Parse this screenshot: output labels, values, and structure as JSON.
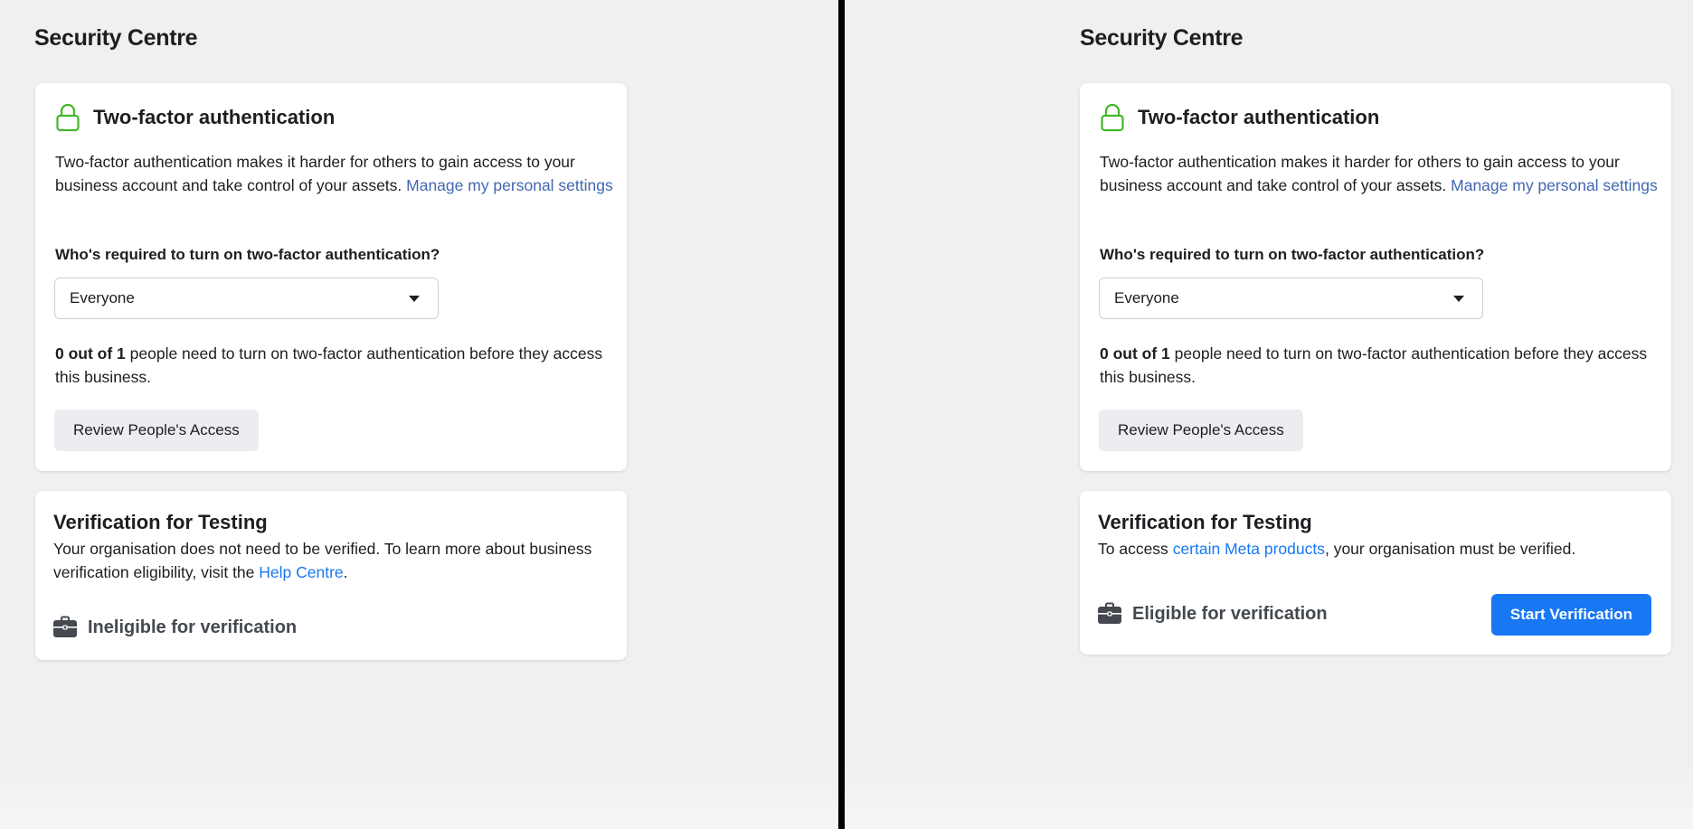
{
  "colors": {
    "background": "#f0f0f0",
    "card": "#ffffff",
    "divider": "#000000",
    "link_muted": "#4267b2",
    "link_blue": "#1877f2",
    "primary_button": "#1877f2",
    "secondary_button": "#ebedf0",
    "lock_icon": "#42b72a"
  },
  "left": {
    "page_title": "Security Centre",
    "tfa": {
      "icon": "lock-icon",
      "title": "Two-factor authentication",
      "desc_text": "Two-factor authentication makes it harder for others to gain access to your business account and take control of your assets. ",
      "desc_link": "Manage my personal settings",
      "question": "Who's required to turn on two-factor authentication?",
      "select_value": "Everyone",
      "count_bold": "0 out of 1",
      "count_rest": " people need to turn on two-factor authentication before they access this business.",
      "review_button": "Review People's Access"
    },
    "verification": {
      "title": "Verification for Testing",
      "desc_before": "Your organisation does not need to be verified. To learn more about business verification eligibility, visit the ",
      "desc_link": "Help Centre",
      "desc_after": ".",
      "icon": "briefcase-icon",
      "status": "Ineligible for verification"
    }
  },
  "right": {
    "page_title": "Security Centre",
    "tfa": {
      "icon": "lock-icon",
      "title": "Two-factor authentication",
      "desc_text": "Two-factor authentication makes it harder for others to gain access to your business account and take control of your assets. ",
      "desc_link": "Manage my personal settings",
      "question": "Who's required to turn on two-factor authentication?",
      "select_value": "Everyone",
      "count_bold": "0 out of 1",
      "count_rest": " people need to turn on two-factor authentication before they access this business.",
      "review_button": "Review People's Access"
    },
    "verification": {
      "title": "Verification for Testing",
      "desc_before": "To access ",
      "desc_link": "certain Meta products",
      "desc_after": ", your organisation must be verified.",
      "icon": "briefcase-icon",
      "status": "Eligible for verification",
      "start_button": "Start Verification"
    }
  }
}
